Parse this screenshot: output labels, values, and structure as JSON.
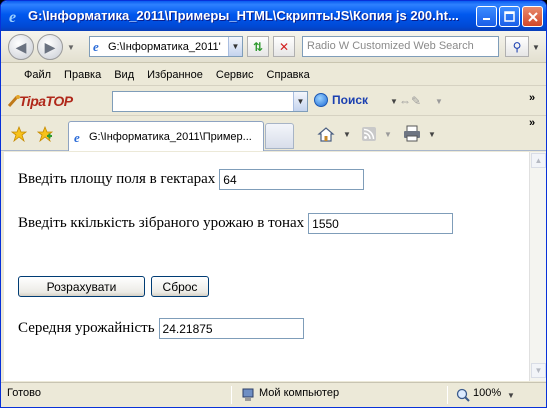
{
  "window": {
    "title": "G:\\Інформатика_2011\\Примеры_HTML\\СкриптыJS\\Копия js 200.ht..."
  },
  "nav": {
    "address": "G:\\Інформатика_2011'",
    "search_placeholder": "Radio W Customized Web Search"
  },
  "menu": {
    "items": [
      "Файл",
      "Правка",
      "Вид",
      "Избранное",
      "Сервис",
      "Справка"
    ]
  },
  "toolbar": {
    "brand": "TipaTOP",
    "search_button": "Поиск"
  },
  "tabs": [
    {
      "label": "G:\\Інформатика_2011\\Пример..."
    }
  ],
  "form": {
    "area_label": "Введіть площу поля в гектарах",
    "area_value": "64",
    "harvest_label": "Введіть ккількість зібраного урожаю в тонах",
    "harvest_value": "1550",
    "calc_button": "Розрахувати",
    "reset_button": "Сброс",
    "result_label": "Середня урожайність",
    "result_value": "24.21875"
  },
  "status": {
    "text": "Готово",
    "zone": "Мой компьютер",
    "zoom": "100%"
  },
  "colors": {
    "titlebar": "#0058EE",
    "field_border": "#7F9DB9",
    "button_border": "#003C74"
  }
}
